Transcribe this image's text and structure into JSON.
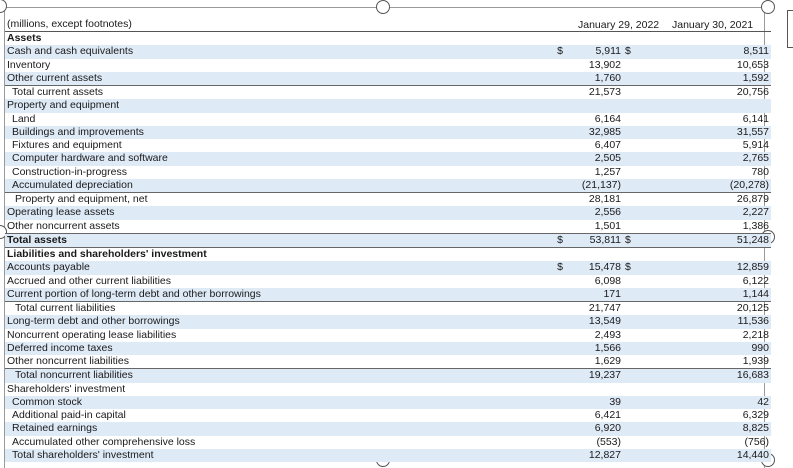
{
  "header": {
    "units": "(millions, except footnotes)",
    "col1": "January 29, 2022",
    "col2": "January 30, 2021"
  },
  "rows": [
    {
      "label": "Assets",
      "v1": "",
      "v2": "",
      "bold": true,
      "band": false,
      "indent": 0,
      "dollar": false
    },
    {
      "label": "Cash and cash equivalents",
      "v1": "5,911",
      "v2": "8,511",
      "band": true,
      "indent": 0,
      "dollar": true
    },
    {
      "label": "Inventory",
      "v1": "13,902",
      "v2": "10,653",
      "band": false,
      "indent": 0,
      "dollar": false
    },
    {
      "label": "Other current assets",
      "v1": "1,760",
      "v2": "1,592",
      "band": true,
      "indent": 0,
      "dollar": false
    },
    {
      "label": "Total current assets",
      "v1": "21,573",
      "v2": "20,756",
      "band": false,
      "indent": 1,
      "dollar": false
    },
    {
      "label": "Property and equipment",
      "v1": "",
      "v2": "",
      "band": true,
      "indent": 0,
      "dollar": false
    },
    {
      "label": "Land",
      "v1": "6,164",
      "v2": "6,141",
      "band": false,
      "indent": 1,
      "dollar": false
    },
    {
      "label": "Buildings and improvements",
      "v1": "32,985",
      "v2": "31,557",
      "band": true,
      "indent": 1,
      "dollar": false
    },
    {
      "label": "Fixtures and equipment",
      "v1": "6,407",
      "v2": "5,914",
      "band": false,
      "indent": 1,
      "dollar": false
    },
    {
      "label": "Computer hardware and software",
      "v1": "2,505",
      "v2": "2,765",
      "band": true,
      "indent": 1,
      "dollar": false
    },
    {
      "label": "Construction-in-progress",
      "v1": "1,257",
      "v2": "780",
      "band": false,
      "indent": 1,
      "dollar": false
    },
    {
      "label": "Accumulated depreciation",
      "v1": "(21,137)",
      "v2": "(20,278)",
      "band": true,
      "indent": 1,
      "dollar": false
    },
    {
      "label": "Property and equipment, net",
      "v1": "28,181",
      "v2": "26,879",
      "band": false,
      "indent": 2,
      "dollar": false
    },
    {
      "label": "Operating lease assets",
      "v1": "2,556",
      "v2": "2,227",
      "band": true,
      "indent": 0,
      "dollar": false
    },
    {
      "label": "Other noncurrent assets",
      "v1": "1,501",
      "v2": "1,386",
      "band": false,
      "indent": 0,
      "dollar": false
    },
    {
      "label": "Total assets",
      "v1": "53,811",
      "v2": "51,248",
      "bold": true,
      "band": true,
      "indent": 0,
      "dollar": true
    },
    {
      "label": "Liabilities and shareholders' investment",
      "v1": "",
      "v2": "",
      "bold": true,
      "band": false,
      "indent": 0,
      "dollar": false
    },
    {
      "label": "Accounts payable",
      "v1": "15,478",
      "v2": "12,859",
      "band": true,
      "indent": 0,
      "dollar": true
    },
    {
      "label": "Accrued and other current liabilities",
      "v1": "6,098",
      "v2": "6,122",
      "band": false,
      "indent": 0,
      "dollar": false
    },
    {
      "label": "Current portion of long-term debt and other borrowings",
      "v1": "171",
      "v2": "1,144",
      "band": true,
      "indent": 0,
      "dollar": false
    },
    {
      "label": "Total current liabilities",
      "v1": "21,747",
      "v2": "20,125",
      "band": false,
      "indent": 2,
      "dollar": false
    },
    {
      "label": "Long-term debt and other borrowings",
      "v1": "13,549",
      "v2": "11,536",
      "band": true,
      "indent": 0,
      "dollar": false
    },
    {
      "label": "Noncurrent operating lease liabilities",
      "v1": "2,493",
      "v2": "2,218",
      "band": false,
      "indent": 0,
      "dollar": false
    },
    {
      "label": "Deferred income taxes",
      "v1": "1,566",
      "v2": "990",
      "band": true,
      "indent": 0,
      "dollar": false
    },
    {
      "label": "Other noncurrent liabilities",
      "v1": "1,629",
      "v2": "1,939",
      "band": false,
      "indent": 0,
      "dollar": false
    },
    {
      "label": "Total noncurrent liabilities",
      "v1": "19,237",
      "v2": "16,683",
      "band": true,
      "indent": 2,
      "dollar": false
    },
    {
      "label": "Shareholders' investment",
      "v1": "",
      "v2": "",
      "band": false,
      "indent": 0,
      "dollar": false
    },
    {
      "label": "Common stock",
      "v1": "39",
      "v2": "42",
      "band": true,
      "indent": 1,
      "dollar": false
    },
    {
      "label": "Additional paid-in capital",
      "v1": "6,421",
      "v2": "6,329",
      "band": false,
      "indent": 1,
      "dollar": false
    },
    {
      "label": "Retained earnings",
      "v1": "6,920",
      "v2": "8,825",
      "band": true,
      "indent": 1,
      "dollar": false
    },
    {
      "label": "Accumulated other comprehensive loss",
      "v1": "(553)",
      "v2": "(756)",
      "band": false,
      "indent": 1,
      "dollar": false
    },
    {
      "label": "Total shareholders' investment",
      "v1": "12,827",
      "v2": "14,440",
      "band": true,
      "indent": 1,
      "dollar": false
    }
  ],
  "currency_symbol": "$"
}
